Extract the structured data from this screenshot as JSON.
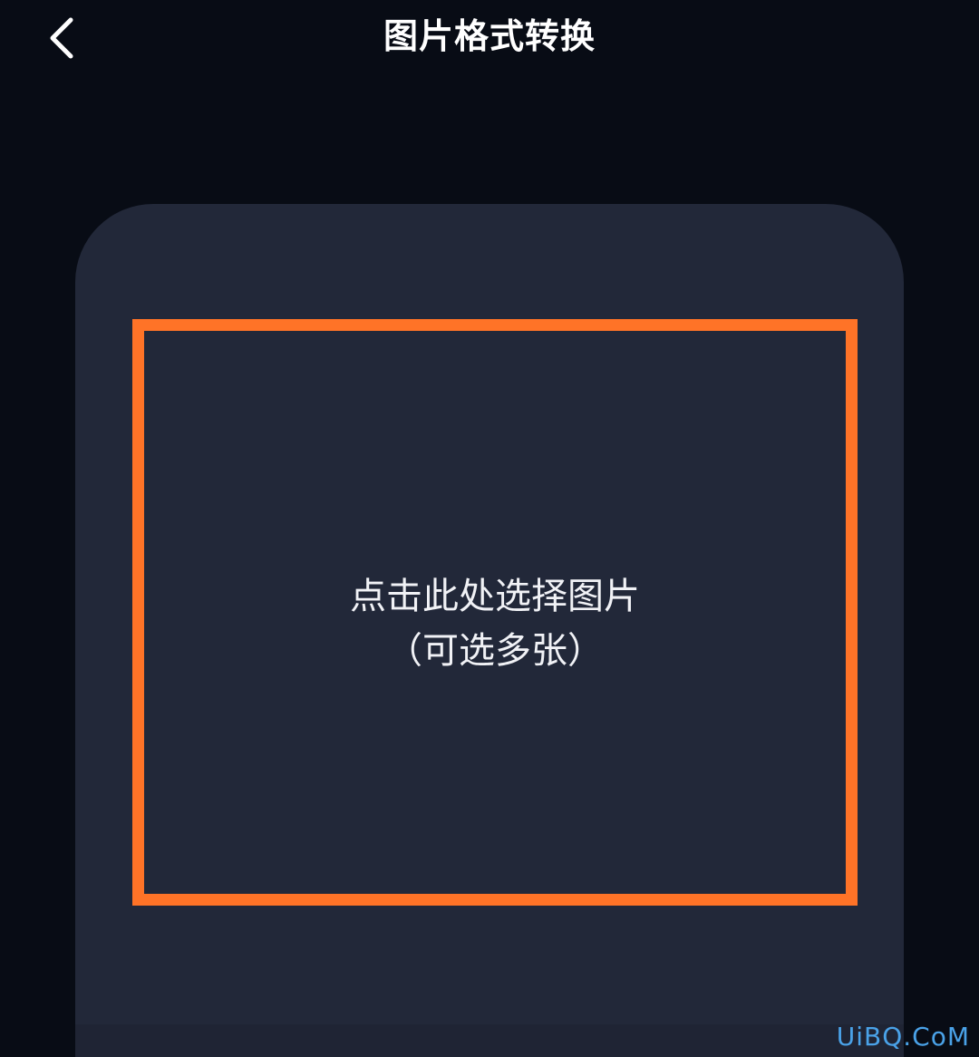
{
  "header": {
    "title": "图片格式转换",
    "back_icon": "chevron-left-icon"
  },
  "upload": {
    "primary_text": "点击此处选择图片",
    "secondary_text": "（可选多张）"
  },
  "watermark": {
    "text": "UiBQ.CoM"
  },
  "colors": {
    "background": "#080c15",
    "card": "#222839",
    "accent_border": "#ff7327",
    "text": "#ffffff",
    "watermark": "#4aa2e8"
  }
}
